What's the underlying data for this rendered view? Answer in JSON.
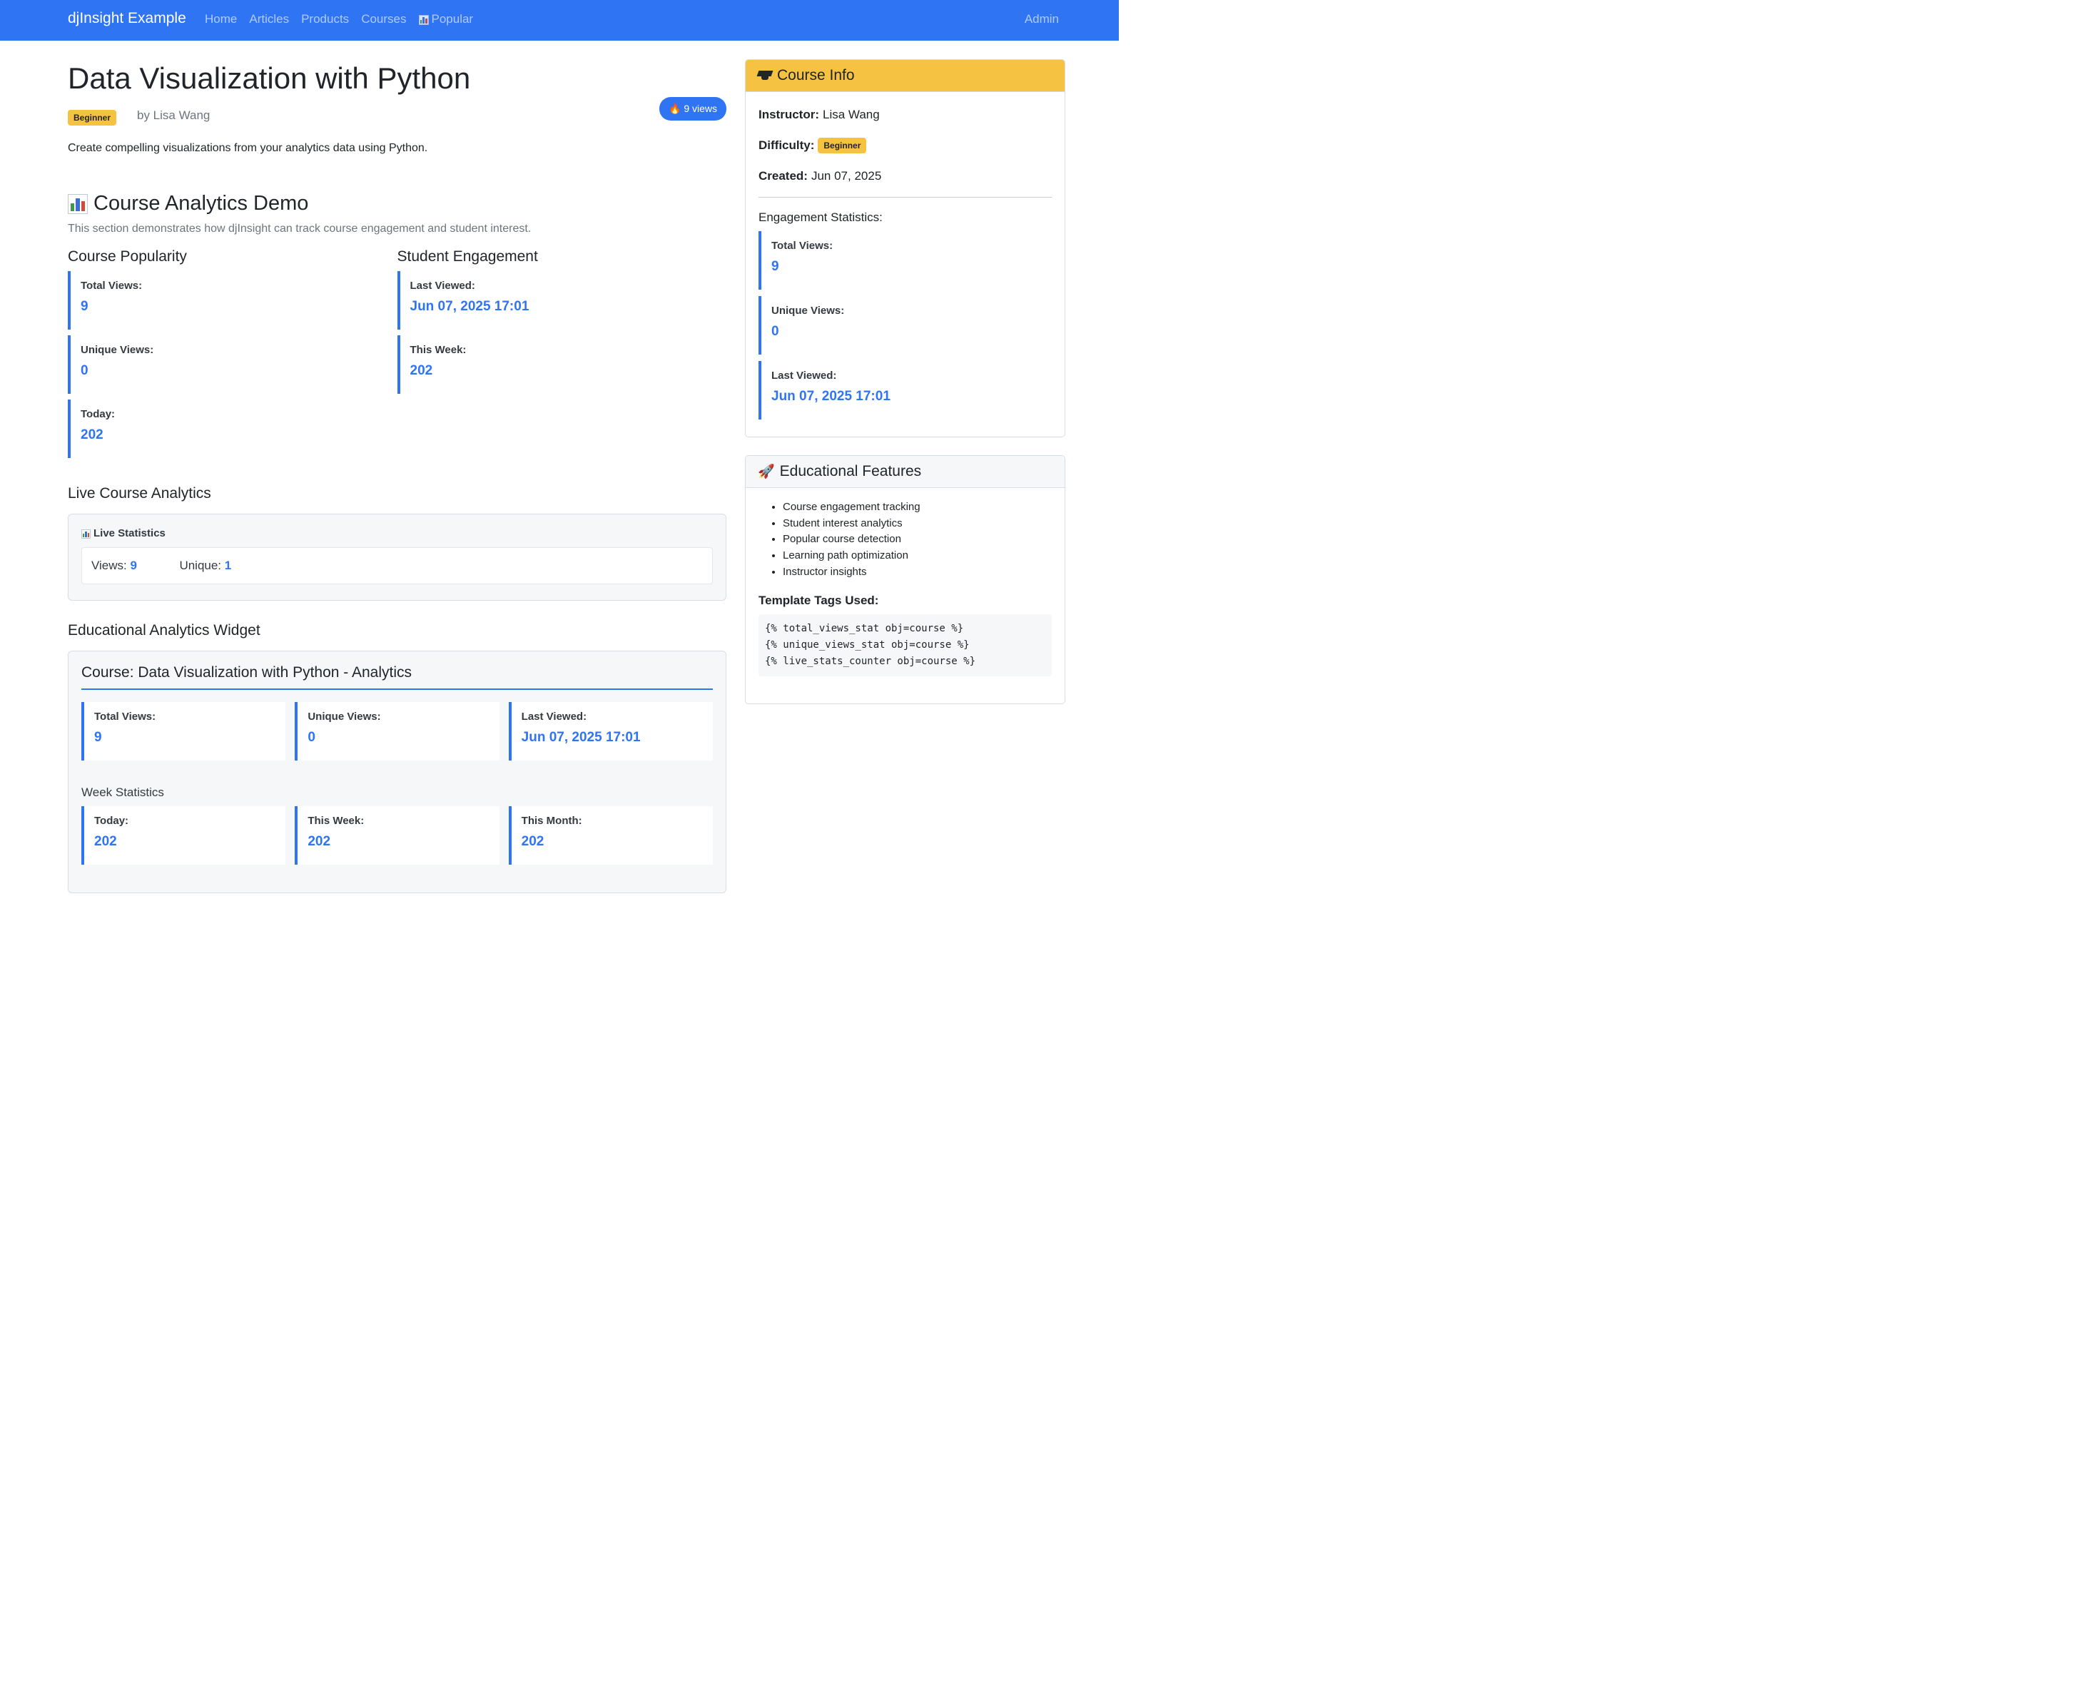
{
  "nav": {
    "brand": "djInsight Example",
    "links": [
      "Home",
      "Articles",
      "Products",
      "Courses",
      "Popular"
    ],
    "admin": "Admin"
  },
  "course": {
    "title": "Data Visualization with Python",
    "difficulty": "Beginner",
    "author": "by Lisa Wang",
    "views_pill": "9 views",
    "description": "Create compelling visualizations from your analytics data using Python."
  },
  "demo": {
    "heading": "Course Analytics Demo",
    "subtitle": "This section demonstrates how djInsight can track course engagement and student interest.",
    "popularity": {
      "heading": "Course Popularity",
      "stats": [
        {
          "label": "Total Views:",
          "value": "9"
        },
        {
          "label": "Unique Views:",
          "value": "0"
        },
        {
          "label": "Today:",
          "value": "202"
        }
      ]
    },
    "engagement": {
      "heading": "Student Engagement",
      "stats": [
        {
          "label": "Last Viewed:",
          "value": "Jun 07, 2025 17:01"
        },
        {
          "label": "This Week:",
          "value": "202"
        }
      ]
    }
  },
  "live": {
    "heading": "Live Course Analytics",
    "box_title": "Live Statistics",
    "views_label": "Views:",
    "views_value": "9",
    "unique_label": "Unique:",
    "unique_value": "1"
  },
  "widget": {
    "heading": "Educational Analytics Widget",
    "title": "Course: Data Visualization with Python - Analytics",
    "stats": [
      {
        "label": "Total Views:",
        "value": "9"
      },
      {
        "label": "Unique Views:",
        "value": "0"
      },
      {
        "label": "Last Viewed:",
        "value": "Jun 07, 2025 17:01"
      }
    ],
    "week_heading": "Week Statistics",
    "week_stats": [
      {
        "label": "Today:",
        "value": "202"
      },
      {
        "label": "This Week:",
        "value": "202"
      },
      {
        "label": "This Month:",
        "value": "202"
      }
    ]
  },
  "sidebar": {
    "info": {
      "heading": "Course Info",
      "instructor_label": "Instructor:",
      "instructor": "Lisa Wang",
      "difficulty_label": "Difficulty:",
      "difficulty": "Beginner",
      "created_label": "Created:",
      "created": "Jun 07, 2025",
      "engagement_heading": "Engagement Statistics:",
      "stats": [
        {
          "label": "Total Views:",
          "value": "9"
        },
        {
          "label": "Unique Views:",
          "value": "0"
        },
        {
          "label": "Last Viewed:",
          "value": "Jun 07, 2025 17:01"
        }
      ]
    },
    "features": {
      "heading": "Educational Features",
      "items": [
        "Course engagement tracking",
        "Student interest analytics",
        "Popular course detection",
        "Learning path optimization",
        "Instructor insights"
      ],
      "tags_heading": "Template Tags Used:",
      "tags": [
        "{% total_views_stat obj=course %}",
        "{% unique_views_stat obj=course %}",
        "{% live_stats_counter obj=course %}"
      ]
    }
  },
  "colors": {
    "primary": "#2f74f3",
    "warning": "#f5c242"
  }
}
